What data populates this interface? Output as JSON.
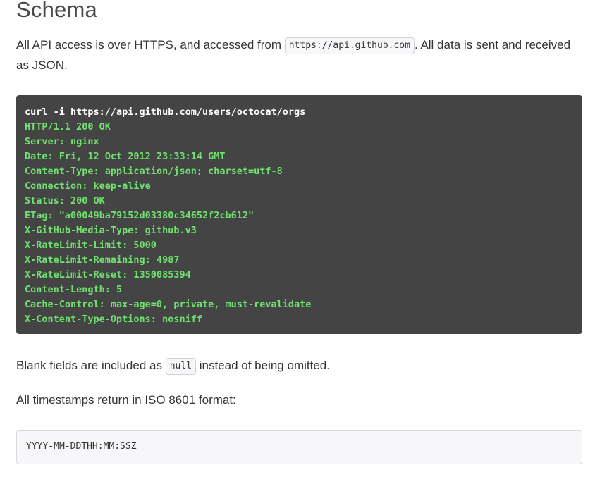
{
  "heading": "Schema",
  "intro": {
    "before": "All API access is over HTTPS, and accessed from ",
    "code": "https://api.github.com",
    "after": ". All data is sent and received as JSON."
  },
  "terminal": {
    "command": "curl -i https://api.github.com/users/octocat/orgs",
    "response_lines": [
      "HTTP/1.1 200 OK",
      "Server: nginx",
      "Date: Fri, 12 Oct 2012 23:33:14 GMT",
      "Content-Type: application/json; charset=utf-8",
      "Connection: keep-alive",
      "Status: 200 OK",
      "ETag: \"a00049ba79152d03380c34652f2cb612\"",
      "X-GitHub-Media-Type: github.v3",
      "X-RateLimit-Limit: 5000",
      "X-RateLimit-Remaining: 4987",
      "X-RateLimit-Reset: 1350085394",
      "Content-Length: 5",
      "Cache-Control: max-age=0, private, must-revalidate",
      "X-Content-Type-Options: nosniff"
    ]
  },
  "blank_fields": {
    "before": "Blank fields are included as ",
    "code": "null",
    "after": " instead of being omitted."
  },
  "timestamps": {
    "text": "All timestamps return in ISO 8601 format:",
    "format": "YYYY-MM-DDTHH:MM:SSZ"
  },
  "colors": {
    "code_bg": "#444444",
    "command": "#ffffff",
    "response": "#6fe26f"
  }
}
